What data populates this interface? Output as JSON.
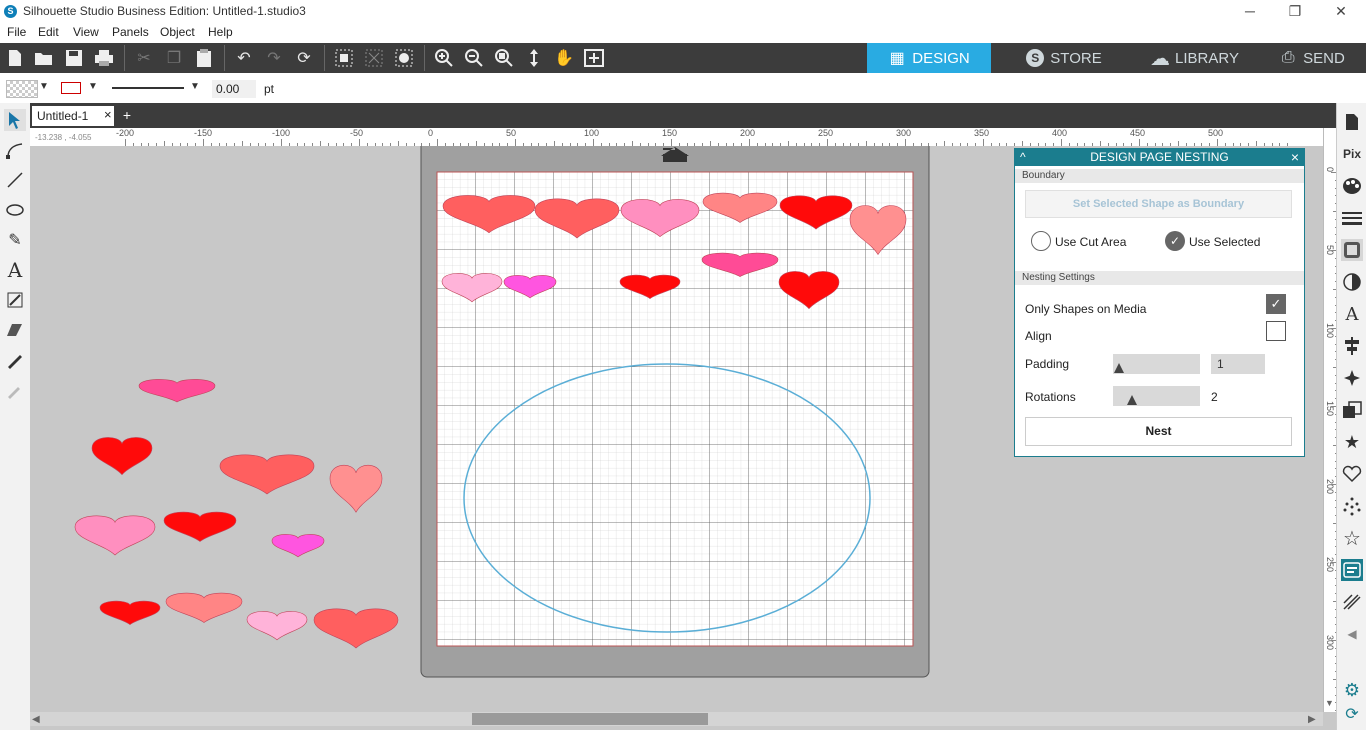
{
  "window": {
    "title": "Silhouette Studio Business Edition: Untitled-1.studio3",
    "app_icon": "S",
    "minimize": "─",
    "restore": "❐",
    "close": "✕"
  },
  "menu": [
    "File",
    "Edit",
    "View",
    "Panels",
    "Object",
    "Help"
  ],
  "nav_tabs": [
    {
      "label": "DESIGN",
      "icon": "grid-icon",
      "glyph": "▦"
    },
    {
      "label": "STORE",
      "icon": "silhouette-s-icon",
      "glyph": "S"
    },
    {
      "label": "LIBRARY",
      "icon": "cloud-icon",
      "glyph": "☁"
    },
    {
      "label": "SEND",
      "icon": "cutter-icon",
      "glyph": "⎙"
    }
  ],
  "props": {
    "line_width": "0.00",
    "unit": "pt"
  },
  "document": {
    "tab_label": "Untitled-1",
    "close_glyph": "×",
    "add_glyph": "+"
  },
  "coords_readout": "-13.238 , -4.055",
  "ruler": {
    "h_labels": [
      "-200",
      "-150",
      "-100",
      "-50",
      "0",
      "50",
      "100",
      "150",
      "200",
      "250",
      "300",
      "350",
      "400",
      "450",
      "500"
    ],
    "v_labels": [
      "0",
      "50",
      "100",
      "150",
      "200",
      "250",
      "300"
    ]
  },
  "nesting_panel": {
    "title": "DESIGN PAGE NESTING",
    "collapse_glyph": "^",
    "close_glyph": "×",
    "boundary_section": "Boundary",
    "set_boundary_button": "Set Selected Shape as Boundary",
    "use_cut_area": "Use Cut Area",
    "use_selected": "Use Selected",
    "selected_boundary": "use_selected",
    "settings_section": "Nesting Settings",
    "only_shapes_label": "Only Shapes on Media",
    "only_shapes_checked": true,
    "align_label": "Align",
    "align_checked": false,
    "padding_label": "Padding",
    "padding_value": "1",
    "rotations_label": "Rotations",
    "rotations_value": "2",
    "nest_button": "Nest"
  },
  "colors": {
    "accent": "#29abe2",
    "panel_header": "#1b7d8e",
    "toolbar": "#3c3c3c",
    "boundary_ellipse": "#5aaed6",
    "heart_salmon": "#ff5f5f",
    "heart_red": "#ff0a0a",
    "heart_pink": "#ff8fbf",
    "heart_lightpink": "#ffb3d9",
    "heart_magenta": "#ff55e0",
    "heart_hotpink": "#ff4b96",
    "heart_peach": "#ff8585",
    "heart_coral": "#ff9090"
  }
}
